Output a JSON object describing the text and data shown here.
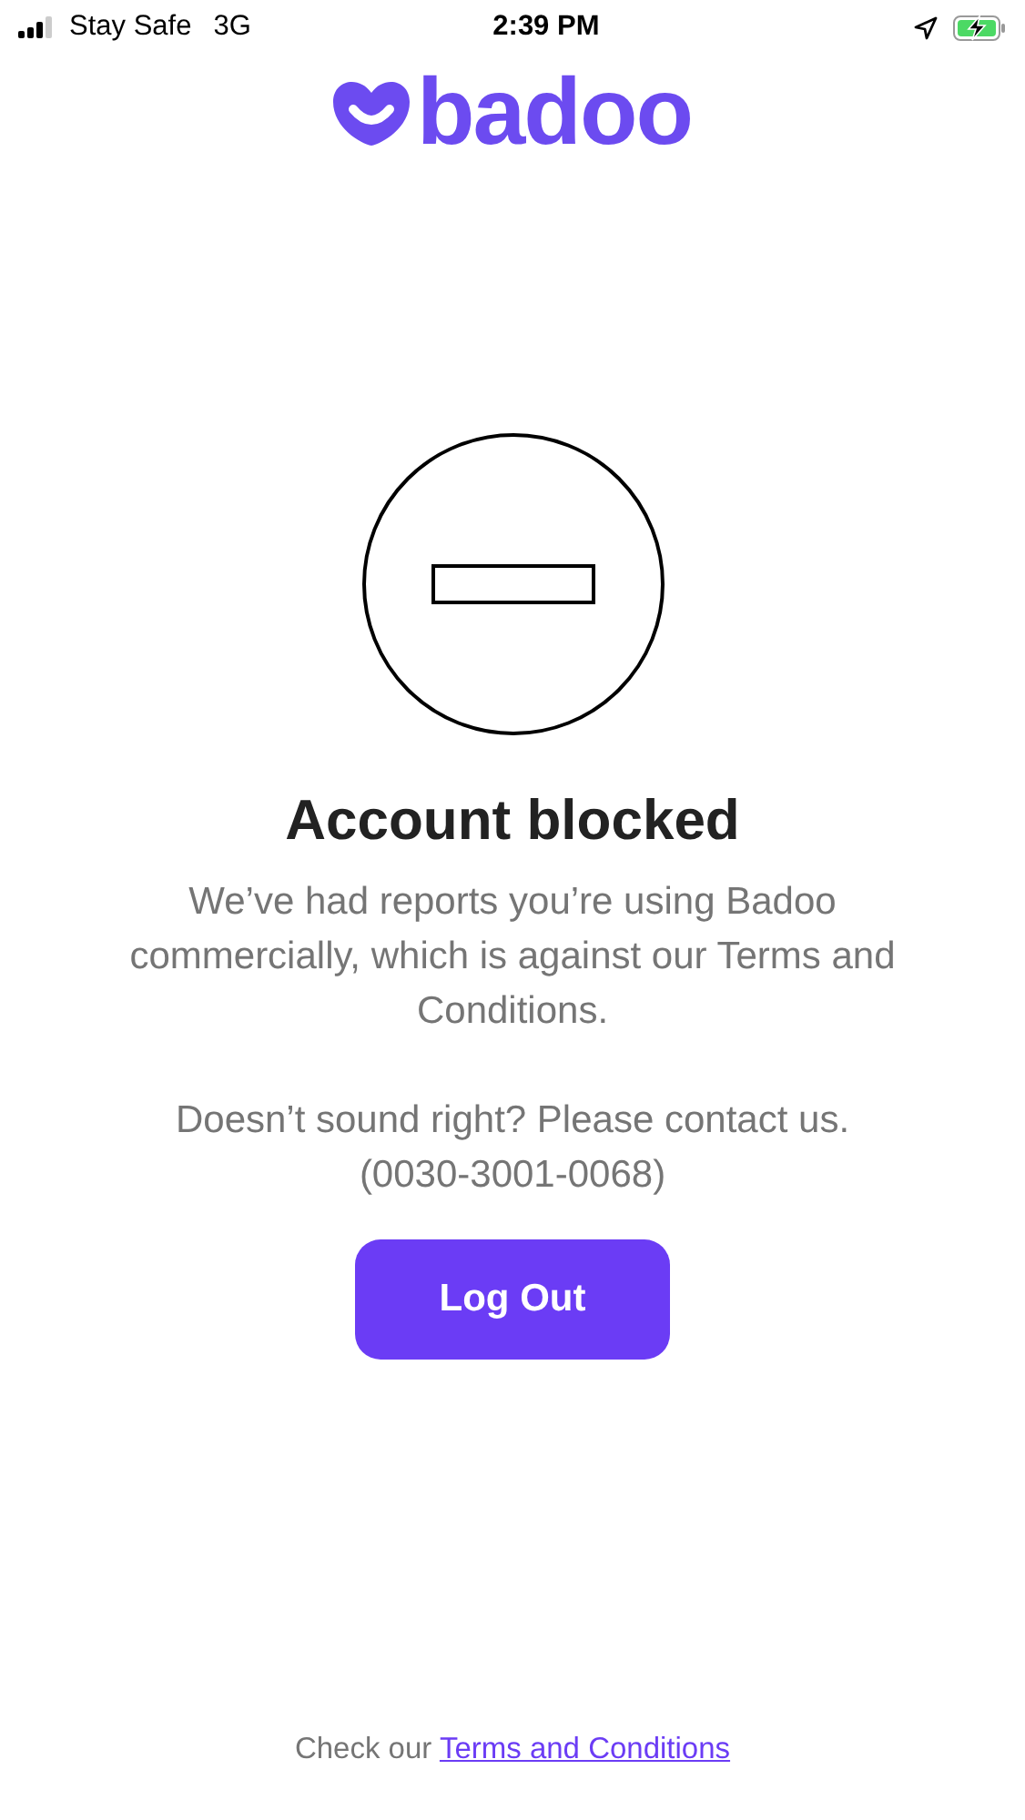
{
  "status_bar": {
    "carrier": "Stay Safe",
    "network": "3G",
    "time": "2:39 PM",
    "charging": true
  },
  "logo": {
    "text": "badoo"
  },
  "title": "Account blocked",
  "message": "We’ve had reports you’re using Badoo commercially, which is against our Terms and Conditions.",
  "contact_prompt": "Doesn’t sound right? Please contact us.",
  "phone": "(0030-3001-0068)",
  "button": "Log Out",
  "footer": {
    "text": "Check our",
    "link": "Terms and Conditions"
  }
}
